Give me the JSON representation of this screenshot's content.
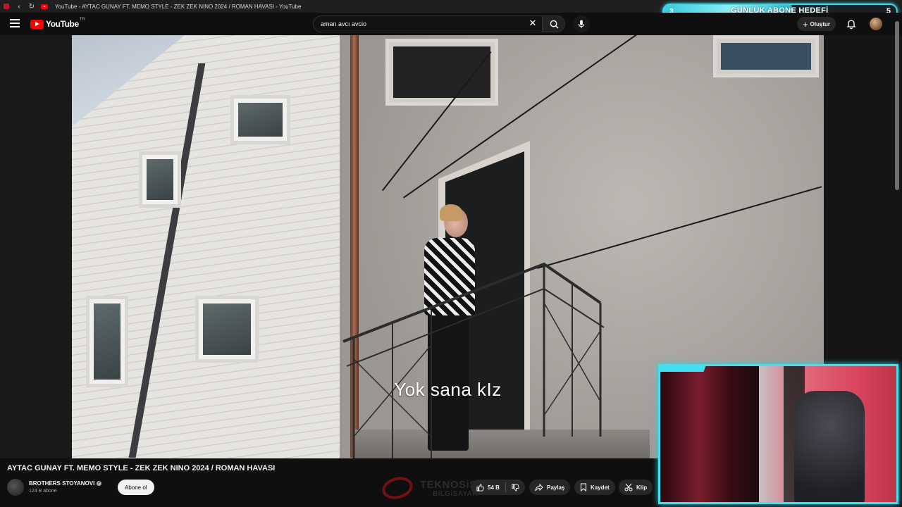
{
  "browser": {
    "tab_title": "YouTube - AYTAC GUNAY FT. MEMO STYLE - ZEK ZEK NINO 2024 / ROMAN HAVASI - YouTube",
    "back_icon": "‹",
    "reload_icon": "↻",
    "minimize_icon": "—",
    "maximize_icon": "▢",
    "close_icon": "✕"
  },
  "overlay_goal": {
    "label": "GÜNLÜK ABONE HEDEFİ",
    "current": "3",
    "target": "5",
    "accent_color": "#3fd8e6"
  },
  "youtube": {
    "logo_text": "YouTube",
    "country_code": "TR",
    "search_value": "aman avcı avcio",
    "create_label": "Oluştur"
  },
  "video": {
    "subtitle": "Yok sana kIz",
    "title": "AYTAC GUNAY FT. MEMO STYLE - ZEK ZEK NINO 2024 / ROMAN HAVASI"
  },
  "channel": {
    "name": "BROTHERS STOYANOVI",
    "subscribers": "124 B abone",
    "subscribe_label": "Abone ol"
  },
  "actions": {
    "likes": "54 B",
    "share": "Paylaş",
    "save": "Kaydet",
    "clip": "Klip"
  },
  "watermark": {
    "line1": "TEKNOSiS",
    "line2": "BiLGiSAYAR"
  }
}
